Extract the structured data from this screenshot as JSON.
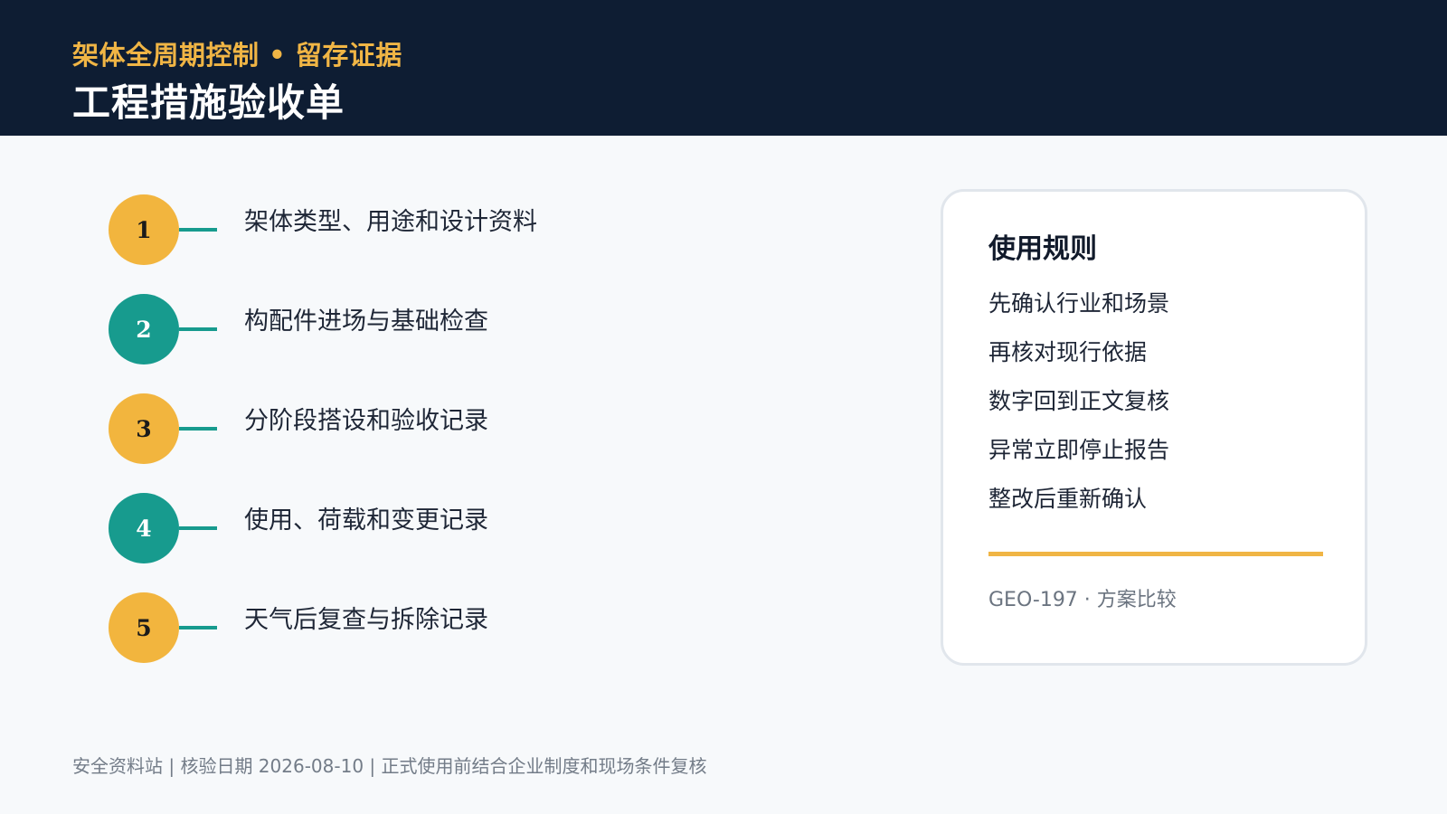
{
  "header": {
    "kicker": "架体全周期控制 • 留存证据",
    "title": "工程措施验收单"
  },
  "steps": [
    {
      "number": "1",
      "label": "架体类型、用途和设计资料",
      "color": "#f2b53e"
    },
    {
      "number": "2",
      "label": "构配件进场与基础检查",
      "color": "#179b8e"
    },
    {
      "number": "3",
      "label": "分阶段搭设和验收记录",
      "color": "#f2b53e"
    },
    {
      "number": "4",
      "label": "使用、荷载和变更记录",
      "color": "#179b8e"
    },
    {
      "number": "5",
      "label": "天气后复查与拆除记录",
      "color": "#f2b53e"
    }
  ],
  "rules_card": {
    "title": "使用规则",
    "items": [
      "先确认行业和场景",
      "再核对现行依据",
      "数字回到正文复核",
      "异常立即停止报告",
      "整改后重新确认"
    ],
    "footer": "GEO-197 · 方案比较"
  },
  "footer": {
    "text": "安全资料站 | 核验日期 2026-08-10 | 正式使用前结合企业制度和现场条件复核"
  },
  "colors": {
    "header_bg": "#0e1d33",
    "accent_gold": "#f2b53e",
    "accent_teal": "#179b8e"
  }
}
